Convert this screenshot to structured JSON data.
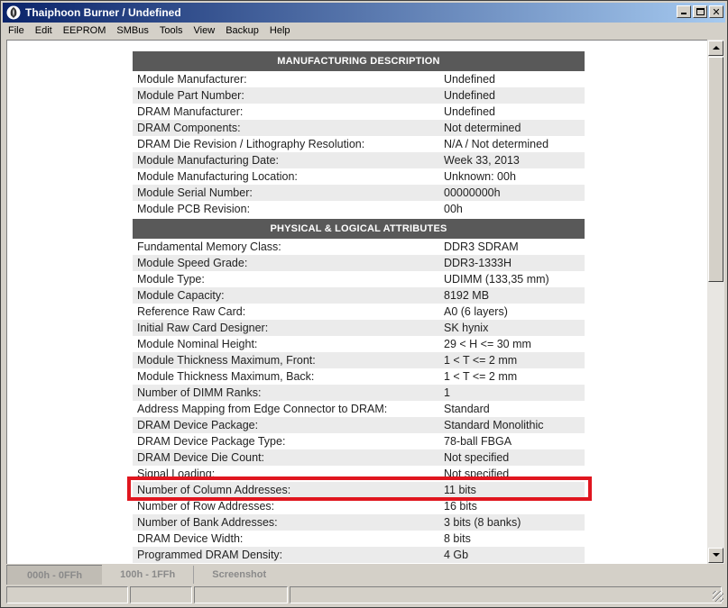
{
  "window": {
    "title": "Thaiphoon Burner / Undefined"
  },
  "menu": {
    "items": [
      "File",
      "Edit",
      "EEPROM",
      "SMBus",
      "Tools",
      "View",
      "Backup",
      "Help"
    ]
  },
  "sections": [
    {
      "header": "MANUFACTURING DESCRIPTION",
      "rows": [
        {
          "label": "Module Manufacturer:",
          "value": "Undefined"
        },
        {
          "label": "Module Part Number:",
          "value": "Undefined"
        },
        {
          "label": "DRAM Manufacturer:",
          "value": "Undefined"
        },
        {
          "label": "DRAM Components:",
          "value": "Not determined"
        },
        {
          "label": "DRAM Die Revision / Lithography Resolution:",
          "value": "N/A / Not determined"
        },
        {
          "label": "Module Manufacturing Date:",
          "value": "Week 33, 2013"
        },
        {
          "label": "Module Manufacturing Location:",
          "value": "Unknown: 00h"
        },
        {
          "label": "Module Serial Number:",
          "value": "00000000h"
        },
        {
          "label": "Module PCB Revision:",
          "value": "00h"
        }
      ]
    },
    {
      "header": "PHYSICAL & LOGICAL ATTRIBUTES",
      "rows": [
        {
          "label": "Fundamental Memory Class:",
          "value": "DDR3 SDRAM"
        },
        {
          "label": "Module Speed Grade:",
          "value": "DDR3-1333H"
        },
        {
          "label": "Module Type:",
          "value": "UDIMM (133,35 mm)"
        },
        {
          "label": "Module Capacity:",
          "value": "8192 MB"
        },
        {
          "label": "Reference Raw Card:",
          "value": "A0 (6 layers)"
        },
        {
          "label": "Initial Raw Card Designer:",
          "value": "SK hynix"
        },
        {
          "label": "Module Nominal Height:",
          "value": "29 < H <= 30 mm"
        },
        {
          "label": "Module Thickness Maximum, Front:",
          "value": "1 < T <= 2 mm"
        },
        {
          "label": "Module Thickness Maximum, Back:",
          "value": "1 < T <= 2 mm"
        },
        {
          "label": "Number of DIMM Ranks:",
          "value": "1"
        },
        {
          "label": "Address Mapping from Edge Connector to DRAM:",
          "value": "Standard"
        },
        {
          "label": "DRAM Device Package:",
          "value": "Standard Monolithic"
        },
        {
          "label": "DRAM Device Package Type:",
          "value": "78-ball FBGA"
        },
        {
          "label": "DRAM Device Die Count:",
          "value": "Not specified"
        },
        {
          "label": "Signal Loading:",
          "value": "Not specified"
        },
        {
          "label": "Number of Column Addresses:",
          "value": "11 bits"
        },
        {
          "label": "Number of Row Addresses:",
          "value": "16 bits"
        },
        {
          "label": "Number of Bank Addresses:",
          "value": "3 bits (8 banks)"
        },
        {
          "label": "DRAM Device Width:",
          "value": "8 bits"
        },
        {
          "label": "Programmed DRAM Density:",
          "value": "4 Gb"
        }
      ]
    }
  ],
  "tabs": [
    "000h - 0FFh",
    "100h - 1FFh",
    "Screenshot"
  ],
  "colors": {
    "titlebar_start": "#0a246a",
    "titlebar_end": "#a6caf0",
    "section_header": "#595959",
    "highlight": "#e0161f"
  }
}
